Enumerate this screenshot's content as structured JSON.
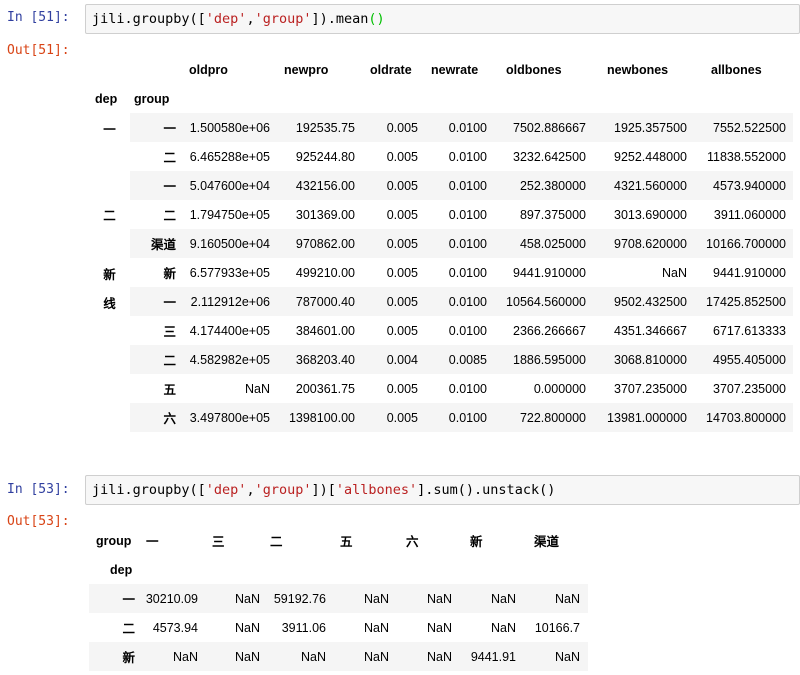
{
  "cell1": {
    "in_prompt": "In  [51]:",
    "code_prefix": "jili.groupby([",
    "code_s1": "'dep'",
    "code_comma": ",",
    "code_s2": "'group'",
    "code_mid": "]).mean",
    "code_paren": "()",
    "out_prompt": "Out[51]:",
    "columns": [
      "oldpro",
      "newpro",
      "oldrate",
      "newrate",
      "oldbones",
      "newbones",
      "allbones"
    ],
    "index_names": [
      "dep",
      "group"
    ],
    "rows": [
      {
        "dep": "一",
        "group": "一",
        "vals": [
          "1.500580e+06",
          "192535.75",
          "0.005",
          "0.0100",
          "7502.886667",
          "1925.357500",
          "7552.522500"
        ]
      },
      {
        "dep": "",
        "group": "二",
        "vals": [
          "6.465288e+05",
          "925244.80",
          "0.005",
          "0.0100",
          "3232.642500",
          "9252.448000",
          "11838.552000"
        ]
      },
      {
        "dep": "二",
        "group": "一",
        "vals": [
          "5.047600e+04",
          "432156.00",
          "0.005",
          "0.0100",
          "252.380000",
          "4321.560000",
          "4573.940000"
        ]
      },
      {
        "dep": "",
        "group": "二",
        "vals": [
          "1.794750e+05",
          "301369.00",
          "0.005",
          "0.0100",
          "897.375000",
          "3013.690000",
          "3911.060000"
        ]
      },
      {
        "dep": "",
        "group": "渠道",
        "vals": [
          "9.160500e+04",
          "970862.00",
          "0.005",
          "0.0100",
          "458.025000",
          "9708.620000",
          "10166.700000"
        ]
      },
      {
        "dep": "新",
        "group": "新",
        "vals": [
          "6.577933e+05",
          "499210.00",
          "0.005",
          "0.0100",
          "9441.910000",
          "NaN",
          "9441.910000"
        ]
      },
      {
        "dep": "线",
        "group": "一",
        "vals": [
          "2.112912e+06",
          "787000.40",
          "0.005",
          "0.0100",
          "10564.560000",
          "9502.432500",
          "17425.852500"
        ]
      },
      {
        "dep": "",
        "group": "三",
        "vals": [
          "4.174400e+05",
          "384601.00",
          "0.005",
          "0.0100",
          "2366.266667",
          "4351.346667",
          "6717.613333"
        ]
      },
      {
        "dep": "",
        "group": "二",
        "vals": [
          "4.582982e+05",
          "368203.40",
          "0.004",
          "0.0085",
          "1886.595000",
          "3068.810000",
          "4955.405000"
        ]
      },
      {
        "dep": "",
        "group": "五",
        "vals": [
          "NaN",
          "200361.75",
          "0.005",
          "0.0100",
          "0.000000",
          "3707.235000",
          "3707.235000"
        ]
      },
      {
        "dep": "",
        "group": "六",
        "vals": [
          "3.497800e+05",
          "1398100.00",
          "0.005",
          "0.0100",
          "722.800000",
          "13981.000000",
          "14703.800000"
        ]
      }
    ]
  },
  "cell2": {
    "in_prompt": "In  [53]:",
    "code_prefix": "jili.groupby([",
    "code_s1": "'dep'",
    "code_comma": ",",
    "code_s2": "'group'",
    "code_mid": "])[",
    "code_s3": "'allbones'",
    "code_end": "].sum().unstack()",
    "out_prompt": "Out[53]:",
    "columns_name": "group",
    "index_name": "dep",
    "columns": [
      "一",
      "三",
      "二",
      "五",
      "六",
      "新",
      "渠道"
    ],
    "rows": [
      {
        "dep": "一",
        "vals": [
          "30210.09",
          "NaN",
          "59192.76",
          "NaN",
          "NaN",
          "NaN",
          "NaN"
        ]
      },
      {
        "dep": "二",
        "vals": [
          "4573.94",
          "NaN",
          "3911.06",
          "NaN",
          "NaN",
          "NaN",
          "10166.7"
        ]
      },
      {
        "dep": "新",
        "vals": [
          "NaN",
          "NaN",
          "NaN",
          "NaN",
          "NaN",
          "9441.91",
          "NaN"
        ]
      }
    ]
  }
}
